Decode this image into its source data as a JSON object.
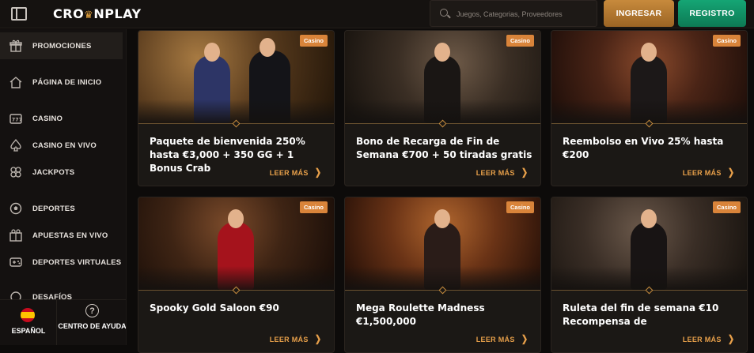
{
  "header": {
    "logo_text_left": "CRO",
    "logo_crown": "♛",
    "logo_text_right": "NPLAY",
    "search_placeholder": "Juegos, Categorias, Proveedores",
    "login_label": "INGRESAR",
    "register_label": "REGISTRO"
  },
  "sidebar": {
    "items": [
      {
        "label": "PROMOCIONES",
        "icon": "gift-icon"
      },
      {
        "label": "PÁGINA DE INICIO",
        "icon": "home-icon"
      },
      {
        "label": "CASINO",
        "icon": "slot-icon"
      },
      {
        "label": "CASINO EN VIVO",
        "icon": "spade-icon"
      },
      {
        "label": "JACKPOTS",
        "icon": "jackpot-icon"
      },
      {
        "label": "DEPORTES",
        "icon": "soccer-ball-icon"
      },
      {
        "label": "APUESTAS EN VIVO",
        "icon": "live-bet-icon"
      },
      {
        "label": "DEPORTES VIRTUALES",
        "icon": "gamepad-icon"
      },
      {
        "label": "DESAFÍOS",
        "icon": "challenge-icon"
      }
    ],
    "language_label": "ESPAÑOL",
    "help_label": "CENTRO DE AYUDA",
    "help_glyph": "?"
  },
  "promos": [
    {
      "badge": "Casino",
      "title": "Paquete de bienvenida 250% hasta €3,000 + 350 GG + 1 Bonus Crab",
      "link": "LEER MÁS"
    },
    {
      "badge": "Casino",
      "title": "Bono de Recarga de Fin de Semana €700 + 50 tiradas gratis",
      "link": "LEER MÁS"
    },
    {
      "badge": "Casino",
      "title": "Reembolso en Vivo 25% hasta €200",
      "link": "LEER MÁS"
    },
    {
      "badge": "Casino",
      "title": "Spooky Gold Saloon €90",
      "link": "LEER MÁS"
    },
    {
      "badge": "Casino",
      "title": "Mega Roulette Madness €1,500,000",
      "link": "LEER MÁS"
    },
    {
      "badge": "Casino",
      "title": "Ruleta del fin de semana €10 Recompensa de",
      "link": "LEER MÁS"
    }
  ],
  "colors": {
    "accent_gold": "#e8a04a",
    "register_green": "#15a574",
    "login_bronze": "#c78a3c",
    "badge_orange": "#d9843a"
  }
}
